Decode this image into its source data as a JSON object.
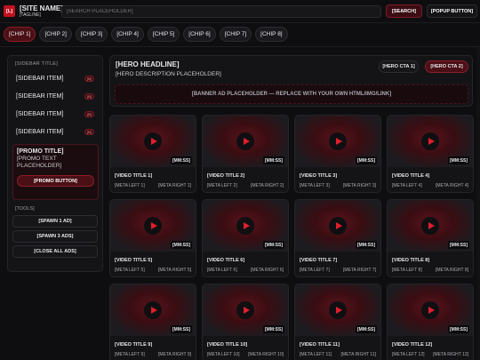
{
  "header": {
    "logo": "[L]",
    "site_name": "[SITE NAME]",
    "tagline": "[TAGLINE]",
    "search_placeholder": "[SEARCH PLACEHOLDER]",
    "search_button": "[SEARCH]",
    "popup_button": "[POPUP BUTTON]"
  },
  "chips": [
    "[CHIP 1]",
    "[CHIP 2]",
    "[CHIP 3]",
    "[CHIP 4]",
    "[CHIP 5]",
    "[CHIP 6]",
    "[CHIP 7]",
    "[CHIP 8]"
  ],
  "sidebar": {
    "title": "[SIDEBAR TITLE]",
    "items": [
      {
        "label": "[SIDEBAR ITEM]",
        "badge": "[B]"
      },
      {
        "label": "[SIDEBAR ITEM]",
        "badge": "[B]"
      },
      {
        "label": "[SIDEBAR ITEM]",
        "badge": "[B]"
      },
      {
        "label": "[SIDEBAR ITEM]",
        "badge": "[B]"
      }
    ],
    "promo": {
      "title": "[PROMO TITLE]",
      "text": "[PROMO TEXT PLACEHOLDER]",
      "button": "[PROMO BUTTON]"
    },
    "tools_heading": "[TOOLS]",
    "tools": [
      "[SPAWN 1 AD]",
      "[SPAWN 3 ADS]",
      "[CLOSE ALL ADS]"
    ]
  },
  "hero": {
    "headline": "[HERO HEADLINE]",
    "description": "[HERO DESCRIPTION PLACEHOLDER]",
    "cta1": "[HERO CTA 1]",
    "cta2": "[HERO CTA 2]",
    "banner": "[BANNER AD PLACEHOLDER — REPLACE WITH YOUR OWN HTML/IMG/LINK]"
  },
  "videos": [
    {
      "title": "[VIDEO TITLE 1]",
      "duration": "[MM:SS]",
      "meta_left": "[META LEFT 1]",
      "meta_right": "[META RIGHT 1]"
    },
    {
      "title": "[VIDEO TITLE 2]",
      "duration": "[MM:SS]",
      "meta_left": "[META LEFT 2]",
      "meta_right": "[META RIGHT 2]"
    },
    {
      "title": "[VIDEO TITLE 3]",
      "duration": "[MM:SS]",
      "meta_left": "[META LEFT 3]",
      "meta_right": "[META RIGHT 3]"
    },
    {
      "title": "[VIDEO TITLE 4]",
      "duration": "[MM:SS]",
      "meta_left": "[META LEFT 4]",
      "meta_right": "[META RIGHT 4]"
    },
    {
      "title": "[VIDEO TITLE 5]",
      "duration": "[MM:SS]",
      "meta_left": "[META LEFT 5]",
      "meta_right": "[META RIGHT 5]"
    },
    {
      "title": "[VIDEO TITLE 6]",
      "duration": "[MM:SS]",
      "meta_left": "[META LEFT 6]",
      "meta_right": "[META RIGHT 6]"
    },
    {
      "title": "[VIDEO TITLE 7]",
      "duration": "[MM:SS]",
      "meta_left": "[META LEFT 7]",
      "meta_right": "[META RIGHT 7]"
    },
    {
      "title": "[VIDEO TITLE 8]",
      "duration": "[MM:SS]",
      "meta_left": "[META LEFT 8]",
      "meta_right": "[META RIGHT 8]"
    },
    {
      "title": "[VIDEO TITLE 9]",
      "duration": "[MM:SS]",
      "meta_left": "[META LEFT 9]",
      "meta_right": "[META RIGHT 9]"
    },
    {
      "title": "[VIDEO TITLE 10]",
      "duration": "[MM:SS]",
      "meta_left": "[META LEFT 10]",
      "meta_right": "[META RIGHT 10]"
    },
    {
      "title": "[VIDEO TITLE 11]",
      "duration": "[MM:SS]",
      "meta_left": "[META LEFT 11]",
      "meta_right": "[META RIGHT 11]"
    },
    {
      "title": "[VIDEO TITLE 12]",
      "duration": "[MM:SS]",
      "meta_left": "[META LEFT 12]",
      "meta_right": "[META RIGHT 12]"
    }
  ],
  "colors": {
    "background": "#0e0e10",
    "panel": "#141417",
    "accent": "#c1121f",
    "play": "#e01e2c"
  },
  "icons": {
    "play": "play-icon",
    "logo": "logo-mark"
  }
}
